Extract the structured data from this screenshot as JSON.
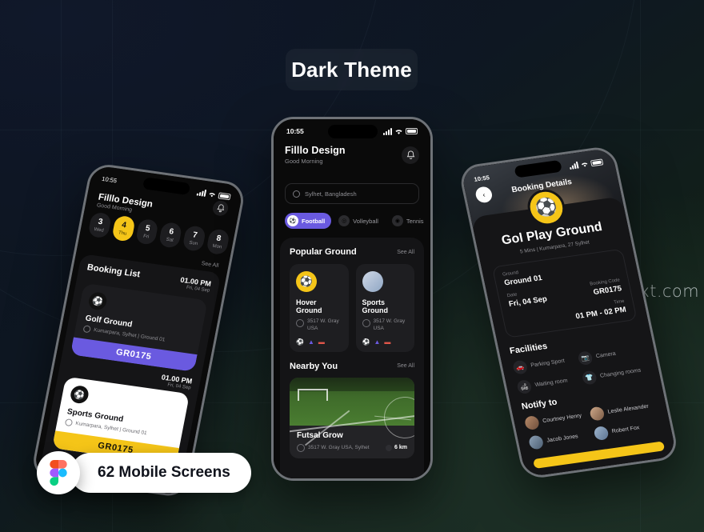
{
  "hero": {
    "theme_label": "Dark Theme",
    "watermark": "www.25xt.com",
    "badge_text": "62 Mobile Screens",
    "figma_icon": "figma-logo-icon"
  },
  "colors": {
    "accent_purple": "#6a5ae0",
    "accent_yellow": "#f5c518",
    "surface": "#151517",
    "card": "#1e1e21",
    "muted_text": "#8e8e93",
    "bg_navy": "#0e1722",
    "bg_green": "#16251c"
  },
  "phone_center": {
    "status": {
      "time": "10:55",
      "signal_icon": "cellular-signal-icon",
      "wifi_icon": "wifi-icon",
      "battery_icon": "battery-icon"
    },
    "header": {
      "app_name": "Filllo Design",
      "greeting": "Good Morning",
      "bell_icon": "bell-icon"
    },
    "search": {
      "placeholder": "Sylhet, Bangladesh",
      "icon": "location-pin-icon"
    },
    "filters": [
      {
        "label": "Football",
        "icon": "football-icon",
        "active": true
      },
      {
        "label": "Volleyball",
        "icon": "volleyball-icon",
        "active": false
      },
      {
        "label": "Tennis",
        "icon": "tennis-icon",
        "active": false
      },
      {
        "label": "",
        "icon": "edit-icon",
        "active": false
      }
    ],
    "popular": {
      "title": "Popular Ground",
      "see_all": "See All",
      "cards": [
        {
          "name": "Hover Ground",
          "address_line1": "3517 W. Gray",
          "address_line2": "USA",
          "avatar_icon": "sports-badge-icon",
          "sport_icons": [
            "football-icon",
            "badminton-icon",
            "pingpong-icon"
          ]
        },
        {
          "name": "Sports Ground",
          "address_line1": "3517 W. Gray",
          "address_line2": "USA",
          "avatar_icon": "team-photo-icon",
          "sport_icons": [
            "football-icon",
            "badminton-icon",
            "pingpong-icon"
          ]
        }
      ]
    },
    "nearby": {
      "title": "Nearby You",
      "see_all": "See All",
      "card": {
        "name": "Futsal Grow",
        "address": "3517 W. Gray USA, Sylhet",
        "distance": "6 km",
        "pin_icon": "location-pin-icon",
        "distance_icon": "distance-icon",
        "image_alt": "futsal-field-photo"
      }
    }
  },
  "phone_left": {
    "status": {
      "time": "10:55",
      "signal_icon": "cellular-signal-icon",
      "wifi_icon": "wifi-icon",
      "battery_icon": "battery-icon"
    },
    "header": {
      "app_name": "Filllo Design",
      "greeting": "Good Morning",
      "bell_icon": "bell-icon"
    },
    "calendar": [
      {
        "day": "3",
        "weekday": "Wed",
        "active": false
      },
      {
        "day": "4",
        "weekday": "Thu",
        "active": true
      },
      {
        "day": "5",
        "weekday": "Fri",
        "active": false
      },
      {
        "day": "6",
        "weekday": "Sat",
        "active": false
      },
      {
        "day": "7",
        "weekday": "Sun",
        "active": false
      },
      {
        "day": "8",
        "weekday": "Mon",
        "active": false
      }
    ],
    "see_all": "See All",
    "booking_list": {
      "title": "Booking List",
      "items": [
        {
          "time": "01.00 PM",
          "date": "Fri, 04 Sep",
          "ground": "Golf Ground",
          "location": "Kumarpara, Sylhet | Ground 01",
          "code": "GR0175",
          "theme": "dark",
          "logo_icon": "boot-ball-icon"
        },
        {
          "time": "01.00 PM",
          "date": "Fri, 04 Sep",
          "ground": "Sports Ground",
          "location": "Kumarpara, Sylhet | Ground 01",
          "code": "GR0175",
          "theme": "light",
          "logo_icon": "boot-ball-icon"
        }
      ]
    }
  },
  "phone_right": {
    "status": {
      "time": "10:55",
      "signal_icon": "cellular-signal-icon",
      "wifi_icon": "wifi-icon",
      "battery_icon": "battery-icon"
    },
    "header": {
      "title": "Booking Details",
      "back_icon": "chevron-left-icon"
    },
    "ground": {
      "logo_icon": "boot-ball-icon",
      "name": "Gol Play Ground",
      "meta": "5 Mins | Kumarpara, 27 Sylhet",
      "meta_icon": "walk-icon"
    },
    "info": [
      {
        "key": "Ground",
        "value": "Ground 01"
      },
      {
        "key": "Date",
        "value": "Fri, 04 Sep"
      },
      {
        "key": "Booking Code",
        "value": "GR0175"
      },
      {
        "key": "Time",
        "value": "01 PM - 02 PM"
      }
    ],
    "facilities": {
      "title": "Facilities",
      "items": [
        {
          "label": "Parking Sport",
          "icon": "car-icon"
        },
        {
          "label": "Camera",
          "icon": "camera-icon"
        },
        {
          "label": "Waiting room",
          "icon": "sofa-icon"
        },
        {
          "label": "Changing rooms",
          "icon": "shirt-icon"
        }
      ]
    },
    "notify": {
      "title": "Notify to",
      "people": [
        {
          "name": "Courtney Henry",
          "avatar": "avatar-icon"
        },
        {
          "name": "Leslie Alexander",
          "avatar": "avatar-icon"
        },
        {
          "name": "Jacob Jones",
          "avatar": "avatar-icon"
        },
        {
          "name": "Robert Fox",
          "avatar": "avatar-icon"
        }
      ]
    },
    "cta_label": ""
  }
}
